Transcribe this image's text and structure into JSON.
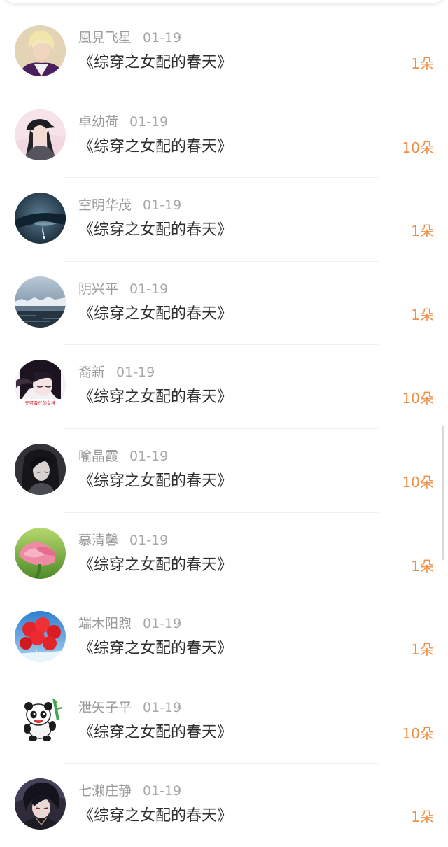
{
  "colors": {
    "name": "#9a9a9a",
    "title": "#2e2e2e",
    "amount": "#ef8e45",
    "divider": "#f0f0f0",
    "background": "#ffffff"
  },
  "items": [
    {
      "name": "風見飞星",
      "date": "01-19",
      "book": "《综穿之女配的春天》",
      "amount": "1朵",
      "avatar": "young man with blond hair in a purple jacket"
    },
    {
      "name": "卓幼荷",
      "date": "01-19",
      "book": "《综穿之女配的春天》",
      "amount": "10朵",
      "avatar": "girl with a black cap"
    },
    {
      "name": "空明华茂",
      "date": "01-19",
      "book": "《综穿之女配的春天》",
      "amount": "1朵",
      "avatar": "dark blue water drop on a hand"
    },
    {
      "name": "阴兴平",
      "date": "01-19",
      "book": "《综穿之女配的春天》",
      "amount": "1朵",
      "avatar": "icy lake landscape"
    },
    {
      "name": "裔新",
      "date": "01-19",
      "book": "《综穿之女配的春天》",
      "amount": "10朵",
      "avatar": "anime girl with text 无可取代的女神"
    },
    {
      "name": "喻晶霞",
      "date": "01-19",
      "book": "《综穿之女配的春天》",
      "amount": "10朵",
      "avatar": "dark-haired anime girl"
    },
    {
      "name": "慕清馨",
      "date": "01-19",
      "book": "《综穿之女配的春天》",
      "amount": "1朵",
      "avatar": "pink flower bud"
    },
    {
      "name": "端木阳煦",
      "date": "01-19",
      "book": "《综穿之女配的春天》",
      "amount": "1朵",
      "avatar": "red balloons against blue sky"
    },
    {
      "name": "泄矢子平",
      "date": "01-19",
      "book": "《综穿之女配的春天》",
      "amount": "10朵",
      "avatar": "cartoon panda holding bamboo"
    },
    {
      "name": "七濑庄静",
      "date": "01-19",
      "book": "《综穿之女配的春天》",
      "amount": "1朵",
      "avatar": "anime man with dark hair"
    }
  ],
  "avatar_badge_text": "无可取代的女神"
}
